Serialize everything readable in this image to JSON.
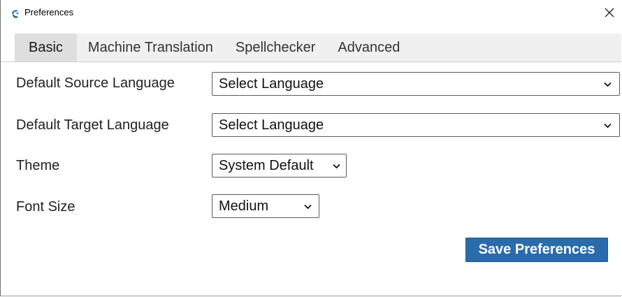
{
  "window": {
    "title": "Preferences"
  },
  "tabs": [
    {
      "label": "Basic",
      "active": true
    },
    {
      "label": "Machine Translation",
      "active": false
    },
    {
      "label": "Spellchecker",
      "active": false
    },
    {
      "label": "Advanced",
      "active": false
    }
  ],
  "form": {
    "source_language": {
      "label": "Default Source Language",
      "value": "Select Language"
    },
    "target_language": {
      "label": "Default Target Language",
      "value": "Select Language"
    },
    "theme": {
      "label": "Theme",
      "value": "System Default"
    },
    "font_size": {
      "label": "Font Size",
      "value": "Medium"
    }
  },
  "actions": {
    "save_label": "Save Preferences"
  },
  "colors": {
    "accent": "#2a6bab",
    "tab_active_bg": "#dedede",
    "tab_bar_bg": "#f0f0f0"
  },
  "icons": {
    "app": "app-logo-icon",
    "close": "close-icon",
    "dropdown": "chevron-down-icon"
  }
}
